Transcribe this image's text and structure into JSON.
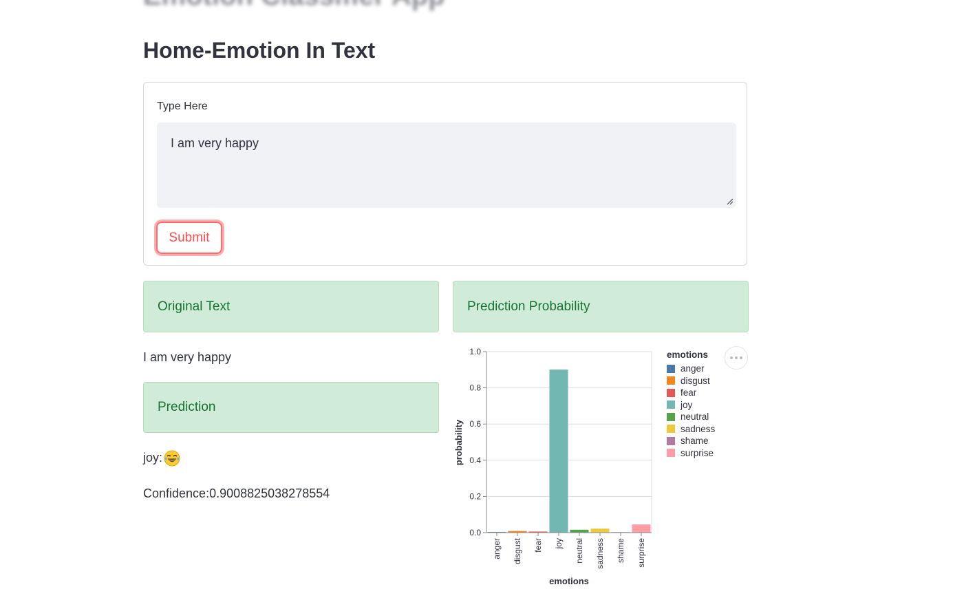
{
  "app": {
    "title": "Emotion Classifier App",
    "heading": "Home-Emotion In Text"
  },
  "form": {
    "label": "Type Here",
    "text_value": "I am very happy",
    "submit_label": "Submit"
  },
  "results": {
    "original_text_header": "Original Text",
    "original_text": "I am very happy",
    "prediction_header": "Prediction",
    "prediction_label": "joy:",
    "prediction_emoji": "face-with-tears-of-joy-icon",
    "confidence": "Confidence:0.9008825038278554",
    "probability_header": "Prediction Probability"
  },
  "colors": {
    "accent": "#ff4b4b",
    "success_bg": "#d0ecd8",
    "success_text": "#177233"
  },
  "chart_data": {
    "type": "bar",
    "title": "",
    "xlabel": "emotions",
    "ylabel": "probability",
    "ylim": [
      0,
      1.0
    ],
    "yticks": [
      "0.0",
      "0.2",
      "0.4",
      "0.6",
      "0.8",
      "1.0"
    ],
    "grid": true,
    "legend_title": "emotions",
    "legend_position": "right",
    "categories": [
      "anger",
      "disgust",
      "fear",
      "joy",
      "neutral",
      "sadness",
      "shame",
      "surprise"
    ],
    "values": [
      0.004,
      0.009,
      0.006,
      0.901,
      0.016,
      0.022,
      0.001,
      0.045
    ],
    "colors": [
      "#4c78a8",
      "#f58518",
      "#e45756",
      "#72b7b2",
      "#54a24b",
      "#eeca3b",
      "#b279a2",
      "#ff9da6"
    ]
  }
}
